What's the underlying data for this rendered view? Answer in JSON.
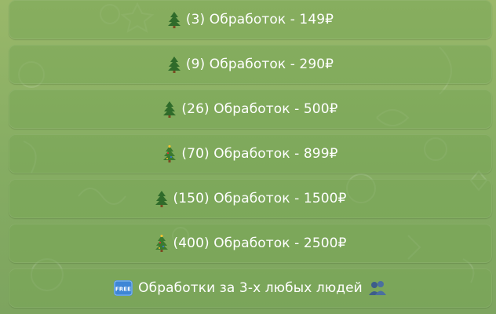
{
  "keyboard": {
    "buttons": [
      {
        "emoji": "christmas-tree-icon",
        "label": "(3) Обработок - 149₽"
      },
      {
        "emoji": "christmas-tree-icon",
        "label": "(9) Обработок - 290₽"
      },
      {
        "emoji": "christmas-tree-icon",
        "label": "(26) Обработок - 500₽"
      },
      {
        "emoji": "decorated-tree-icon",
        "label": "(70) Обработок - 899₽"
      },
      {
        "emoji": "christmas-tree-icon",
        "label": "(150) Обработок - 1500₽"
      },
      {
        "emoji": "decorated-tree-icon",
        "label": "(400) Обработок - 2500₽"
      },
      {
        "emoji": "free-badge-icon",
        "label": "Обработки за 3-х любых людей",
        "emoji_after": "people-silhouette-icon"
      }
    ]
  },
  "colors": {
    "background_top": "#9ab86a",
    "background_bottom": "#7da45f",
    "button_fill": "#7aa455",
    "text": "#ffffff"
  }
}
